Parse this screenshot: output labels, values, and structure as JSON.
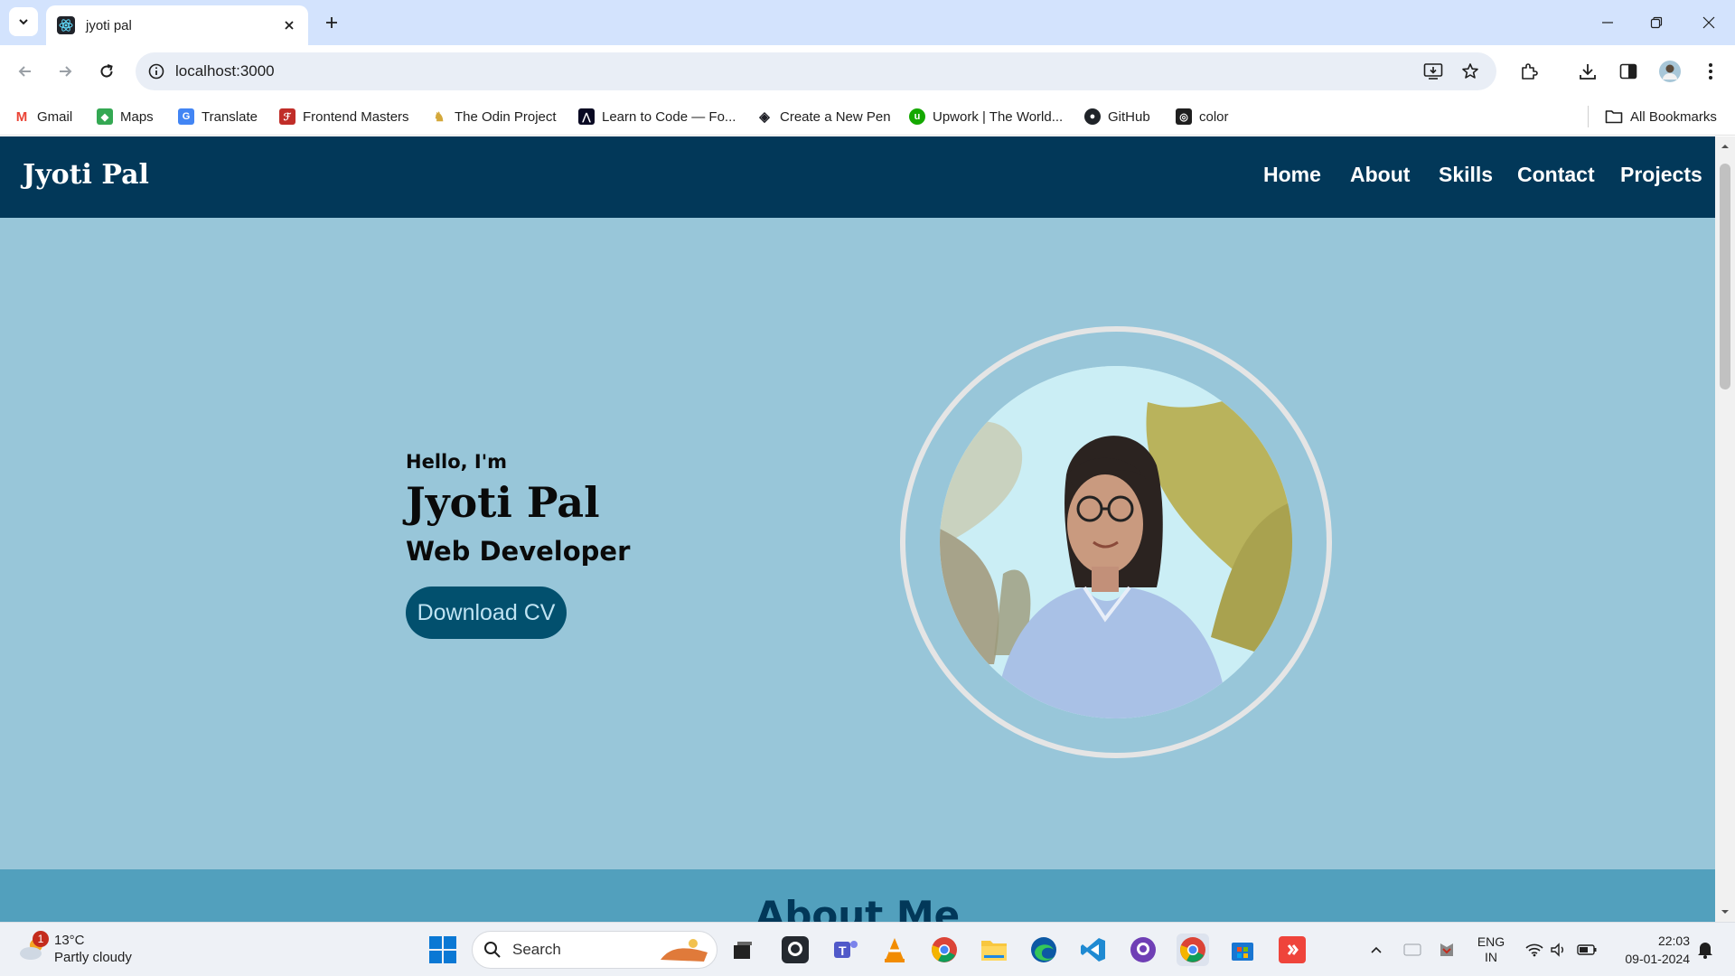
{
  "browser": {
    "tab_title": "jyoti pal",
    "url": "localhost:3000",
    "bookmarks": [
      {
        "label": "Gmail",
        "icon": "gmail-icon",
        "color": "#ea4335"
      },
      {
        "label": "Maps",
        "icon": "maps-icon",
        "color": "#34a853"
      },
      {
        "label": "Translate",
        "icon": "translate-icon",
        "color": "#4285f4"
      },
      {
        "label": "Frontend Masters",
        "icon": "frontend-masters-icon",
        "color": "#c02d28"
      },
      {
        "label": "The Odin Project",
        "icon": "odin-project-icon",
        "color": "#d4a83a"
      },
      {
        "label": "Learn to Code — Fo...",
        "icon": "freecodecamp-icon",
        "color": "#0a0a23"
      },
      {
        "label": "Create a New Pen",
        "icon": "codepen-icon",
        "color": "#1e1f26"
      },
      {
        "label": "Upwork | The World...",
        "icon": "upwork-icon",
        "color": "#14a800"
      },
      {
        "label": "GitHub",
        "icon": "github-icon",
        "color": "#1f2328"
      },
      {
        "label": "color",
        "icon": "color-icon",
        "color": "#1f1f1f"
      }
    ],
    "all_bookmarks": "All Bookmarks"
  },
  "site": {
    "brand": "Jyoti Pal",
    "nav": [
      "Home",
      "About",
      "Skills",
      "Contact",
      "Projects"
    ],
    "hero": {
      "greeting": "Hello, I'm",
      "name": "Jyoti Pal",
      "role": "Web Developer",
      "cta": "Download CV"
    },
    "about_title": "About Me",
    "colors": {
      "nav_bg": "#023859",
      "hero_bg": "#98c6d9",
      "about_bg": "#52a0bd",
      "button_bg": "#02506e"
    }
  },
  "taskbar": {
    "weather_temp": "13°C",
    "weather_desc": "Partly cloudy",
    "weather_badge": "1",
    "search_placeholder": "Search",
    "lang_top": "ENG",
    "lang_bottom": "IN",
    "time": "22:03",
    "date": "09-01-2024"
  }
}
